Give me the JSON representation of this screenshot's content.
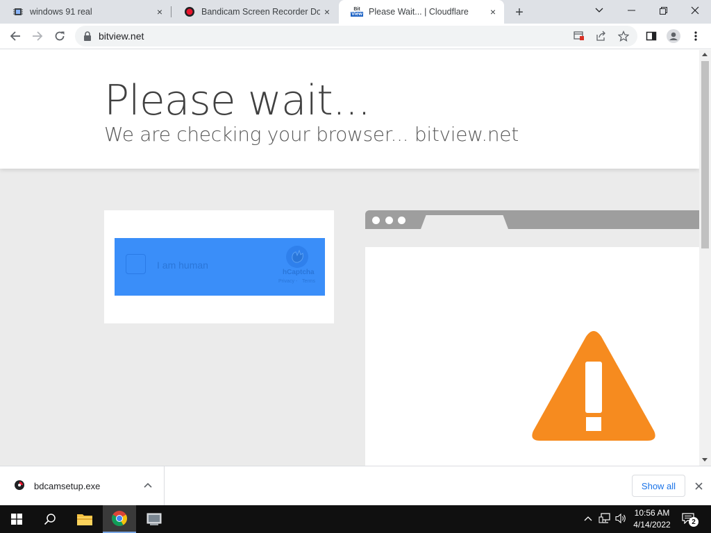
{
  "tabs": [
    {
      "title": "windows 91 real",
      "favicon": "chip-icon",
      "close": "×"
    },
    {
      "title": "Bandicam Screen Recorder Dow",
      "favicon": "record-icon",
      "close": "×"
    },
    {
      "title": "Please Wait... | Cloudflare",
      "favicon": "bitview-icon",
      "favicon_text_top": "Bit",
      "favicon_text_bottom": "View",
      "close": "×",
      "active": true
    }
  ],
  "new_tab_label": "+",
  "window_controls": {
    "tab_search": "⌄",
    "minimize": "–",
    "maximize": "❐",
    "close": "✕"
  },
  "toolbar": {
    "url": "bitview.net",
    "icons": [
      "back-icon",
      "forward-icon",
      "reload-icon",
      "lock-icon",
      "install-app-icon",
      "share-icon",
      "star-icon",
      "side-panel-icon",
      "profile-icon",
      "menu-icon"
    ]
  },
  "page": {
    "heading": "Please wait...",
    "subheading": "We are checking your browser... bitview.net",
    "captcha": {
      "label": "I am human",
      "brand": "hCaptcha",
      "privacy": "Privacy",
      "separator": "-",
      "terms": "Terms",
      "accent": "#3a8ef9"
    },
    "warning_color": "#f68b1f"
  },
  "download_shelf": {
    "filename": "bdcamsetup.exe",
    "show_all": "Show all",
    "close": "✕"
  },
  "taskbar": {
    "time": "10:56 AM",
    "date": "4/14/2022",
    "notification_count": "2",
    "items": [
      "windows-start-icon",
      "search-icon",
      "file-explorer-icon",
      "chrome-icon",
      "app-icon"
    ]
  }
}
